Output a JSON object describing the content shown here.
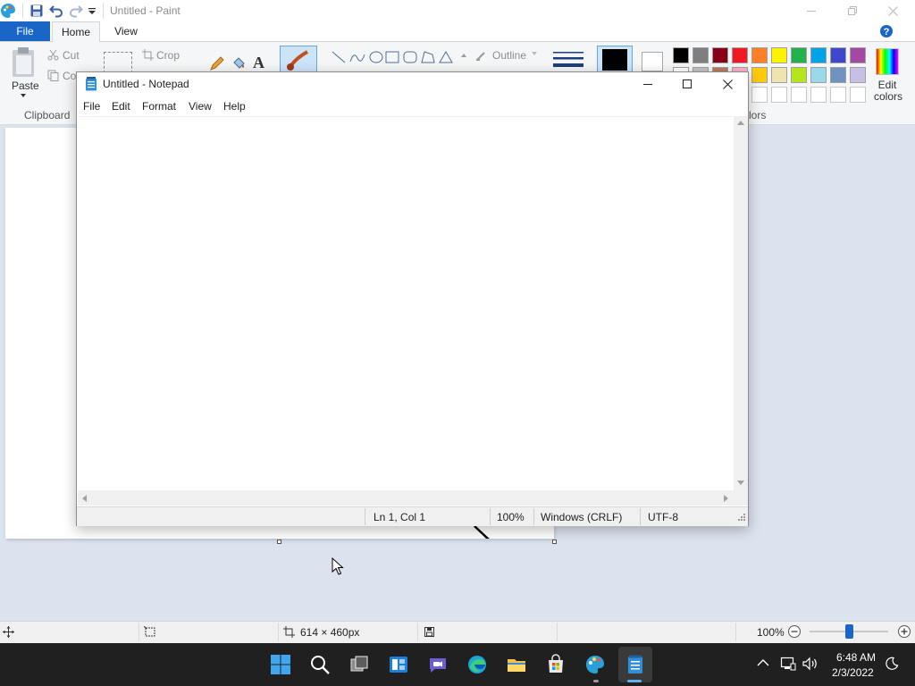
{
  "paint": {
    "title": "Untitled - Paint",
    "tabs": {
      "file": "File",
      "home": "Home",
      "view": "View"
    },
    "clipboard": {
      "paste": "Paste",
      "cut": "Cut",
      "copy_partial": "Co",
      "group": "Clipboard"
    },
    "image": {
      "crop": "Crop"
    },
    "shapes": {
      "outline": "Outline"
    },
    "colors": {
      "edit_colors_line1": "Edit",
      "edit_colors_line2": "colors",
      "group_partial": "lors",
      "row1": [
        "#000000",
        "#7f7f7f",
        "#880015",
        "#ed1c24",
        "#ff7f27",
        "#fff200",
        "#22b14c",
        "#00a2e8",
        "#3f48cc",
        "#a349a4"
      ],
      "row2": [
        "#ffffff",
        "#c3c3c3",
        "#b97a57",
        "#ffaec9",
        "#ffc90e",
        "#efe4b0",
        "#b5e61d",
        "#99d9ea",
        "#7092be",
        "#c8bfe7"
      ]
    },
    "status": {
      "image_size": "614 × 460px",
      "zoom": "100%"
    }
  },
  "notepad": {
    "title": "Untitled - Notepad",
    "menu": [
      "File",
      "Edit",
      "Format",
      "View",
      "Help"
    ],
    "content": "",
    "status": {
      "position": "Ln 1, Col 1",
      "zoom": "100%",
      "line_ending": "Windows (CRLF)",
      "encoding": "UTF-8"
    }
  },
  "taskbar": {
    "time": "6:48 AM",
    "date": "2/3/2022"
  }
}
